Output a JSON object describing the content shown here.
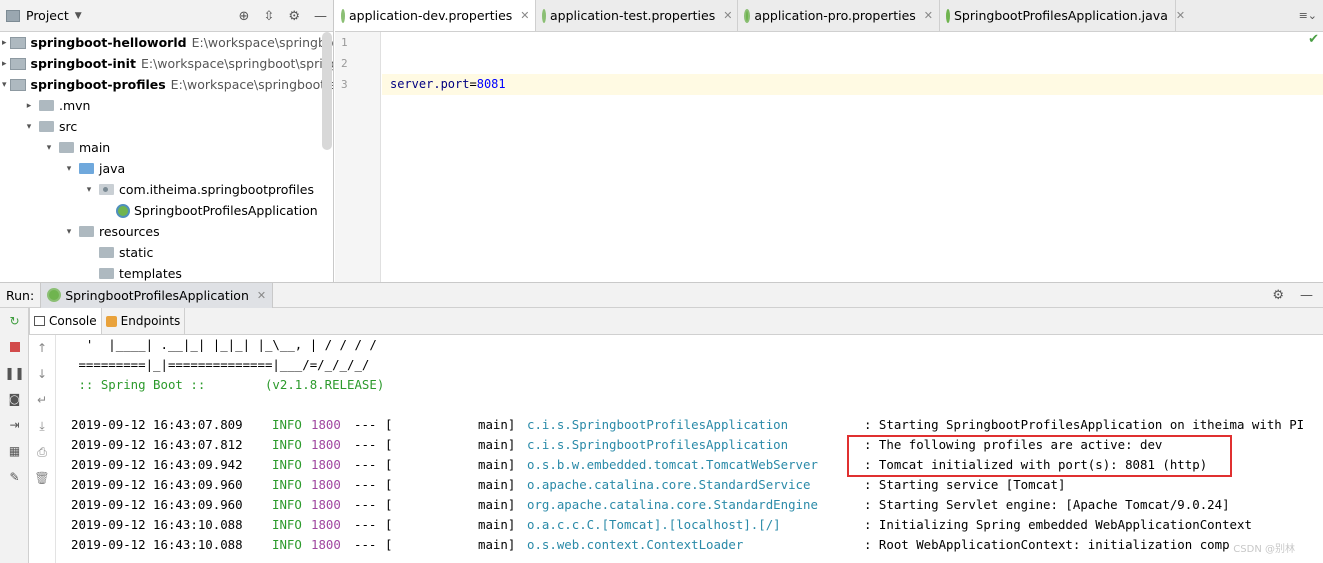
{
  "project_panel": {
    "title": "Project",
    "tree": [
      {
        "label": "springboot-helloworld",
        "path": "E:\\workspace\\springboot",
        "indent": 0,
        "arrow": "›",
        "icon": "module",
        "bold": true
      },
      {
        "label": "springboot-init",
        "path": "E:\\workspace\\springboot\\springb",
        "indent": 0,
        "arrow": "›",
        "icon": "module",
        "bold": true
      },
      {
        "label": "springboot-profiles",
        "path": "E:\\workspace\\springboot\\sp",
        "indent": 0,
        "arrow": "⌄",
        "icon": "module",
        "bold": true
      },
      {
        "label": ".mvn",
        "path": "",
        "indent": 1,
        "arrow": "›",
        "icon": "folder",
        "bold": false
      },
      {
        "label": "src",
        "path": "",
        "indent": 1,
        "arrow": "⌄",
        "icon": "folder",
        "bold": false
      },
      {
        "label": "main",
        "path": "",
        "indent": 2,
        "arrow": "⌄",
        "icon": "folder",
        "bold": false
      },
      {
        "label": "java",
        "path": "",
        "indent": 3,
        "arrow": "⌄",
        "icon": "folder-blue",
        "bold": false
      },
      {
        "label": "com.itheima.springbootprofiles",
        "path": "",
        "indent": 4,
        "arrow": "⌄",
        "icon": "package",
        "bold": false
      },
      {
        "label": "SpringbootProfilesApplication",
        "path": "",
        "indent": 5,
        "arrow": "",
        "icon": "spring",
        "bold": false
      },
      {
        "label": "resources",
        "path": "",
        "indent": 3,
        "arrow": "⌄",
        "icon": "folder",
        "bold": false
      },
      {
        "label": "static",
        "path": "",
        "indent": 4,
        "arrow": "",
        "icon": "folder",
        "bold": false
      },
      {
        "label": "templates",
        "path": "",
        "indent": 4,
        "arrow": "",
        "icon": "folder",
        "bold": false
      }
    ]
  },
  "editor": {
    "tabs": [
      {
        "label": "application-dev.properties",
        "active": true,
        "icon": "properties"
      },
      {
        "label": "application-test.properties",
        "active": false,
        "icon": "properties"
      },
      {
        "label": "application-pro.properties",
        "active": false,
        "icon": "properties"
      },
      {
        "label": "SpringbootProfilesApplication.java",
        "active": false,
        "icon": "java"
      }
    ],
    "line_numbers": [
      "1",
      "2",
      "3"
    ],
    "code": {
      "key": "server.port",
      "eq": "=",
      "value": "8081"
    }
  },
  "run_panel": {
    "label": "Run:",
    "config_tab": "SpringbootProfilesApplication",
    "console_tab": "Console",
    "endpoints_tab": "Endpoints",
    "banner_lines": [
      "  '  |____| .__|_| |_|_| |_\\__, | / / / /",
      " =========|_|==============|___/=/_/_/_/",
      " :: Spring Boot ::        (v2.1.8.RELEASE)"
    ],
    "log": [
      {
        "ts": "2019-09-12 16:43:07.809",
        "level": "INFO",
        "pid": "1800",
        "sep": "---",
        "bracket": "[",
        "thread": "main]",
        "logger": "c.i.s.SpringbootProfilesApplication",
        "msg": ": Starting SpringbootProfilesApplication on itheima with PI"
      },
      {
        "ts": "2019-09-12 16:43:07.812",
        "level": "INFO",
        "pid": "1800",
        "sep": "---",
        "bracket": "[",
        "thread": "main]",
        "logger": "c.i.s.SpringbootProfilesApplication",
        "msg": ": The following profiles are active: dev"
      },
      {
        "ts": "2019-09-12 16:43:09.942",
        "level": "INFO",
        "pid": "1800",
        "sep": "---",
        "bracket": "[",
        "thread": "main]",
        "logger": "o.s.b.w.embedded.tomcat.TomcatWebServer",
        "msg": ": Tomcat initialized with port(s): 8081 (http)"
      },
      {
        "ts": "2019-09-12 16:43:09.960",
        "level": "INFO",
        "pid": "1800",
        "sep": "---",
        "bracket": "[",
        "thread": "main]",
        "logger": "o.apache.catalina.core.StandardService",
        "msg": ": Starting service [Tomcat]"
      },
      {
        "ts": "2019-09-12 16:43:09.960",
        "level": "INFO",
        "pid": "1800",
        "sep": "---",
        "bracket": "[",
        "thread": "main]",
        "logger": "org.apache.catalina.core.StandardEngine",
        "msg": ": Starting Servlet engine: [Apache Tomcat/9.0.24]"
      },
      {
        "ts": "2019-09-12 16:43:10.088",
        "level": "INFO",
        "pid": "1800",
        "sep": "---",
        "bracket": "[",
        "thread": "main]",
        "logger": "o.a.c.c.C.[Tomcat].[localhost].[/]",
        "msg": ": Initializing Spring embedded WebApplicationContext"
      },
      {
        "ts": "2019-09-12 16:43:10.088",
        "level": "INFO",
        "pid": "1800",
        "sep": "---",
        "bracket": "[",
        "thread": "main]",
        "logger": "o.s.web.context.ContextLoader",
        "msg": ": Root WebApplicationContext: initialization comp"
      }
    ],
    "watermark": "CSDN @别林"
  },
  "colors": {
    "highlight": "#e03030",
    "info": "#2c9a2c",
    "logger": "#2a8aa8",
    "pid": "#a046a0"
  }
}
